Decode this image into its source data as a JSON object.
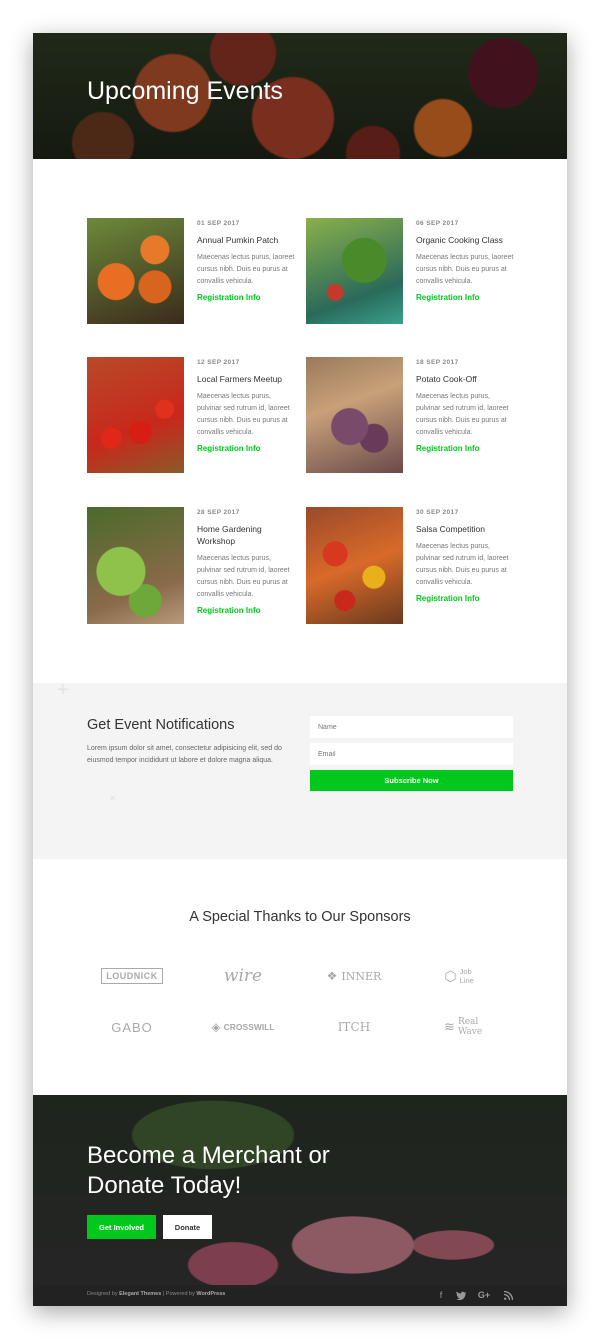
{
  "hero": {
    "title": "Upcoming Events"
  },
  "events": [
    {
      "date": "01 SEP 2017",
      "title": "Annual Pumkin Patch",
      "description": "Maecenas lectus purus, laoreet cursus nibh. Duis eu purus at convallis vehicula.",
      "link": "Registration Info"
    },
    {
      "date": "06 SEP 2017",
      "title": "Organic Cooking Class",
      "description": "Maecenas lectus purus, laoreet cursus nibh. Duis eu purus at convallis vehicula.",
      "link": "Registration Info"
    },
    {
      "date": "12 SEP 2017",
      "title": "Local Farmers Meetup",
      "description": "Maecenas lectus purus, pulvinar sed rutrum id, laoreet cursus nibh. Duis eu purus at convallis vehicula.",
      "link": "Registration Info"
    },
    {
      "date": "18 SEP 2017",
      "title": "Potato Cook-Off",
      "description": "Maecenas lectus purus, pulvinar sed rutrum id, laoreet cursus nibh. Duis eu purus at convallis vehicula.",
      "link": "Registration Info"
    },
    {
      "date": "28 SEP 2017",
      "title": "Home Gardening Workshop",
      "description": "Maecenas lectus purus, pulvinar sed rutrum id, laoreet cursus nibh. Duis eu purus at convallis vehicula.",
      "link": "Registration Info"
    },
    {
      "date": "30 SEP 2017",
      "title": "Salsa Competition",
      "description": "Maecenas lectus purus, pulvinar sed rutrum id, laoreet cursus nibh. Duis eu purus at convallis vehicula.",
      "link": "Registration Info"
    }
  ],
  "notifications": {
    "title": "Get Event Notifications",
    "text": "Lorem ipsum dolor sit amet, consectetur adipisicing elit, sed do eiusmod tempor incididunt ut labore et dolore magna aliqua.",
    "name_placeholder": "Name",
    "email_placeholder": "Email",
    "subscribe_label": "Subscribe Now"
  },
  "sponsors": {
    "title": "A Special Thanks to Our Sponsors",
    "logos": [
      "LOUDNICK",
      "wire",
      "INNER",
      "Job Line",
      "GABO",
      "CROSSWILL",
      "ITCH",
      "Real Wave"
    ]
  },
  "cta": {
    "title_line1": "Become a Merchant or",
    "title_line2": "Donate Today!",
    "primary_label": "Get Involved",
    "secondary_label": "Donate"
  },
  "footer": {
    "designed_by": "Designed by",
    "designer": "Elegant Themes",
    "separator": "|",
    "powered_by": "Powered by",
    "platform": "WordPress",
    "social_icons": [
      "facebook-icon",
      "twitter-icon",
      "google-plus-icon",
      "rss-icon"
    ]
  },
  "colors": {
    "accent": "#00c81c",
    "footer_bg": "#222222",
    "notify_bg": "#f4f4f4"
  }
}
